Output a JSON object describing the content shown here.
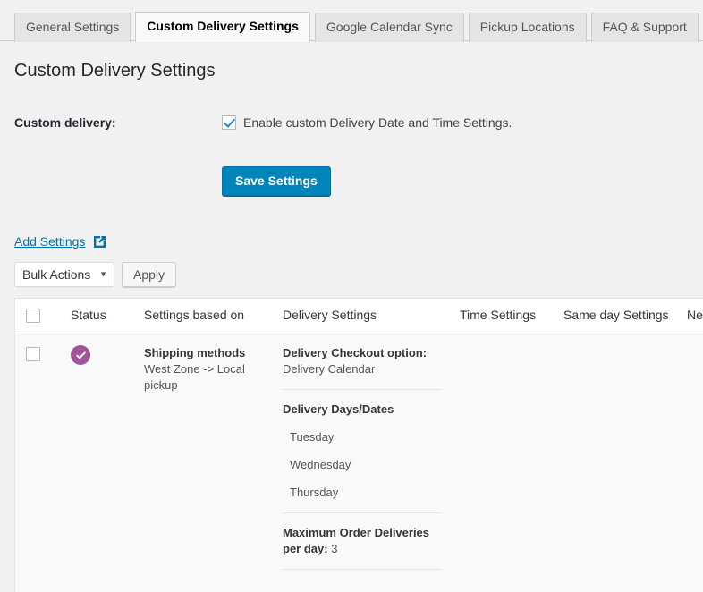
{
  "tabs": [
    {
      "label": "General Settings",
      "active": false
    },
    {
      "label": "Custom Delivery Settings",
      "active": true
    },
    {
      "label": "Google Calendar Sync",
      "active": false
    },
    {
      "label": "Pickup Locations",
      "active": false
    },
    {
      "label": "FAQ & Support",
      "active": false
    }
  ],
  "page": {
    "title": "Custom Delivery Settings"
  },
  "form": {
    "label": "Custom delivery:",
    "checkbox_label": "Enable custom Delivery Date and Time Settings.",
    "checkbox_checked": true,
    "save_label": "Save Settings",
    "save_color": "#0085ba"
  },
  "add_settings": {
    "label": "Add Settings",
    "icon": "external-link-icon",
    "color": "#0073aa"
  },
  "bulk": {
    "selected": "Bulk Actions",
    "options": [
      "Bulk Actions"
    ],
    "apply_label": "Apply"
  },
  "table": {
    "headers": {
      "status": "Status",
      "based_on": "Settings based on",
      "delivery": "Delivery Settings",
      "time": "Time Settings",
      "same_day": "Same day Settings",
      "next_day": "Next day Settings"
    },
    "row": {
      "status_icon": "check-circle-icon",
      "status_color": "#a0549b",
      "based_on_title": "Shipping methods",
      "based_on_value": "West Zone -> Local pickup",
      "checkout_option_label": "Delivery Checkout option:",
      "checkout_option_value": "Delivery Calendar",
      "days_heading": "Delivery Days/Dates",
      "days": [
        "Tuesday",
        "Wednesday",
        "Thursday"
      ],
      "max_label": "Maximum Order Deliveries per day:",
      "max_value": "3",
      "time_settings": "",
      "same_day_settings": "",
      "next_day_settings": ""
    }
  }
}
